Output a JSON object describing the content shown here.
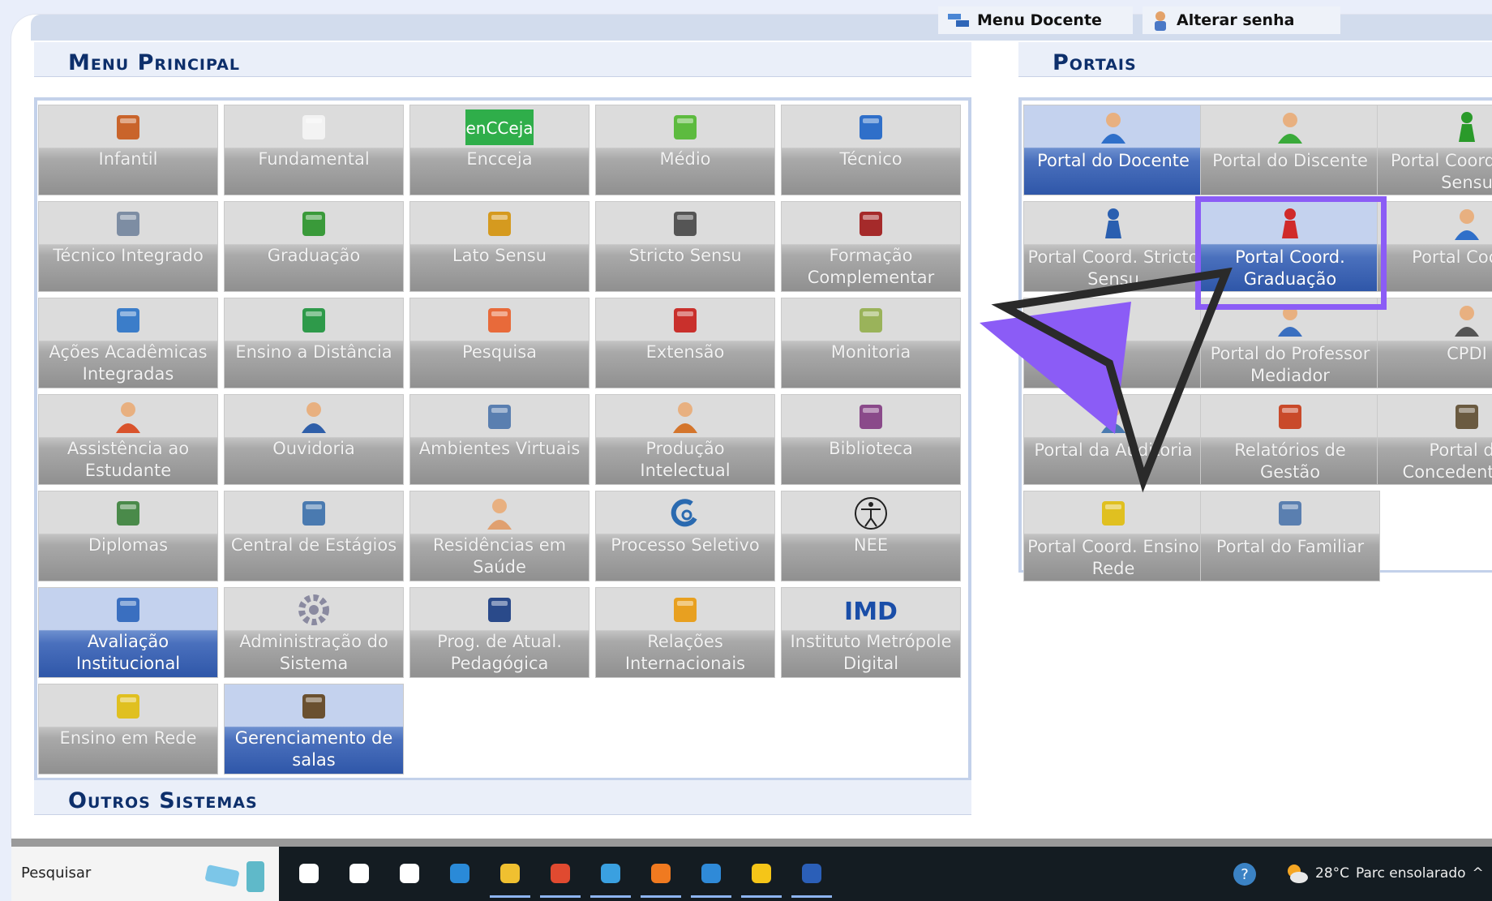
{
  "top_links": [
    {
      "label": "Menu Docente",
      "icon": "menu-docente-icon"
    },
    {
      "label": "Alterar senha",
      "icon": "user-key-icon"
    }
  ],
  "menu_principal": {
    "title": "Menu Principal",
    "tiles": [
      {
        "label": "Infantil",
        "icon": "crayons-icon",
        "active": false
      },
      {
        "label": "Fundamental",
        "icon": "notebook-icon",
        "active": false
      },
      {
        "label": "Encceja",
        "icon": "encceja-logo",
        "logo_text": "enCCeja",
        "active": false
      },
      {
        "label": "Médio",
        "icon": "pencil-icon",
        "active": false
      },
      {
        "label": "Técnico",
        "icon": "blue-book-icon",
        "active": false
      },
      {
        "label": "Técnico Integrado",
        "icon": "drafting-icon",
        "active": false
      },
      {
        "label": "Graduação",
        "icon": "books-stack-icon",
        "active": false
      },
      {
        "label": "Lato Sensu",
        "icon": "folder-icon",
        "active": false
      },
      {
        "label": "Stricto Sensu",
        "icon": "briefcase-icon",
        "active": false
      },
      {
        "label": "Formação Complementar",
        "icon": "red-book-icon",
        "active": false
      },
      {
        "label": "Ações Acadêmicas Integradas",
        "icon": "puzzle-icon",
        "active": false
      },
      {
        "label": "Ensino a Distância",
        "icon": "globe-mouse-icon",
        "active": false
      },
      {
        "label": "Pesquisa",
        "icon": "flask-icon",
        "active": false
      },
      {
        "label": "Extensão",
        "icon": "houses-icon",
        "active": false
      },
      {
        "label": "Monitoria",
        "icon": "presentation-board-icon",
        "active": false
      },
      {
        "label": "Assistência ao Estudante",
        "icon": "student-help-icon",
        "active": false
      },
      {
        "label": "Ouvidoria",
        "icon": "headset-person-icon",
        "active": false
      },
      {
        "label": "Ambientes Virtuais",
        "icon": "people-group-icon",
        "active": false
      },
      {
        "label": "Produção Intelectual",
        "icon": "person-check-icon",
        "active": false
      },
      {
        "label": "Biblioteca",
        "icon": "open-book-icon",
        "active": false
      },
      {
        "label": "Diplomas",
        "icon": "certificate-icon",
        "active": false
      },
      {
        "label": "Central de Estágios",
        "icon": "id-card-icon",
        "active": false
      },
      {
        "label": "Residências em Saúde",
        "icon": "doctor-icon",
        "active": false
      },
      {
        "label": "Processo Seletivo",
        "icon": "swirl-logo-icon",
        "active": false
      },
      {
        "label": "NEE",
        "icon": "accessibility-icon",
        "active": false
      },
      {
        "label": "Avaliação Institucional",
        "icon": "checked-document-icon",
        "active": true
      },
      {
        "label": "Administração do Sistema",
        "icon": "gear-icon",
        "active": false
      },
      {
        "label": "Prog. de Atual. Pedagógica",
        "icon": "monitor-icon",
        "active": false
      },
      {
        "label": "Relações Internacionais",
        "icon": "world-map-icon",
        "active": false
      },
      {
        "label": "Instituto Metrópole Digital",
        "icon": "imd-logo",
        "logo_text": "IMD",
        "active": false
      },
      {
        "label": "Ensino em Rede",
        "icon": "brazil-at-icon",
        "active": false
      },
      {
        "label": "Gerenciamento de salas",
        "icon": "buildings-icon",
        "active": true
      }
    ]
  },
  "outros_sistemas": {
    "title": "Outros Sistemas"
  },
  "portais": {
    "title": "Portais",
    "tiles": [
      {
        "label": "Portal do Docente",
        "icon": "teacher-avatar-icon",
        "active": true
      },
      {
        "label": "Portal do Discente",
        "icon": "green-student-icon",
        "active": false
      },
      {
        "label": "Portal Coord. Lato Sensu",
        "icon": "green-pawn-icon",
        "active": false
      },
      {
        "label": "Portal Coord. Stricto Sensu",
        "icon": "blue-pawn-icon",
        "active": false
      },
      {
        "label": "Portal Coord. Graduação",
        "icon": "red-pawn-icon",
        "active": true
      },
      {
        "label": "Portal Coord.",
        "icon": "person-tie-icon",
        "active": false
      },
      {
        "label": "",
        "icon": "person-avatar-icon",
        "active": false
      },
      {
        "label": "Portal do Professor Mediador",
        "icon": "mediator-avatar-icon",
        "active": false
      },
      {
        "label": "CPDI",
        "icon": "grey-person-icon",
        "active": false
      },
      {
        "label": "Portal da Auditoria",
        "icon": "auditor-icon",
        "active": false
      },
      {
        "label": "Relatórios de Gestão",
        "icon": "report-chart-icon",
        "active": false
      },
      {
        "label": "Portal do Concedente de Estágio",
        "icon": "id-badge-icon",
        "active": false
      },
      {
        "label": "Portal Coord. Ensino Rede",
        "icon": "brazil-at-icon",
        "active": false
      },
      {
        "label": "Portal do Familiar",
        "icon": "family-icon",
        "active": false
      }
    ]
  },
  "taskbar": {
    "search_label": "Pesquisar",
    "apps": [
      "travel-icon",
      "task-view-icon",
      "cortana-icon",
      "mail-icon",
      "edge-icon",
      "file-explorer-icon",
      "chrome-icon",
      "store-icon",
      "firefox-icon",
      "chrome-profile-icon",
      "sticky-notes-icon",
      "word-icon"
    ],
    "help_icon": "help-icon",
    "weather": {
      "temp": "28°C",
      "desc": "Parc ensolarado",
      "icon": "partly-sunny-icon"
    },
    "chevron": "^"
  },
  "colors": {
    "highlight": "#8b5cf6",
    "title": "#0d2f6b",
    "active_tile": "#2e56a8"
  }
}
